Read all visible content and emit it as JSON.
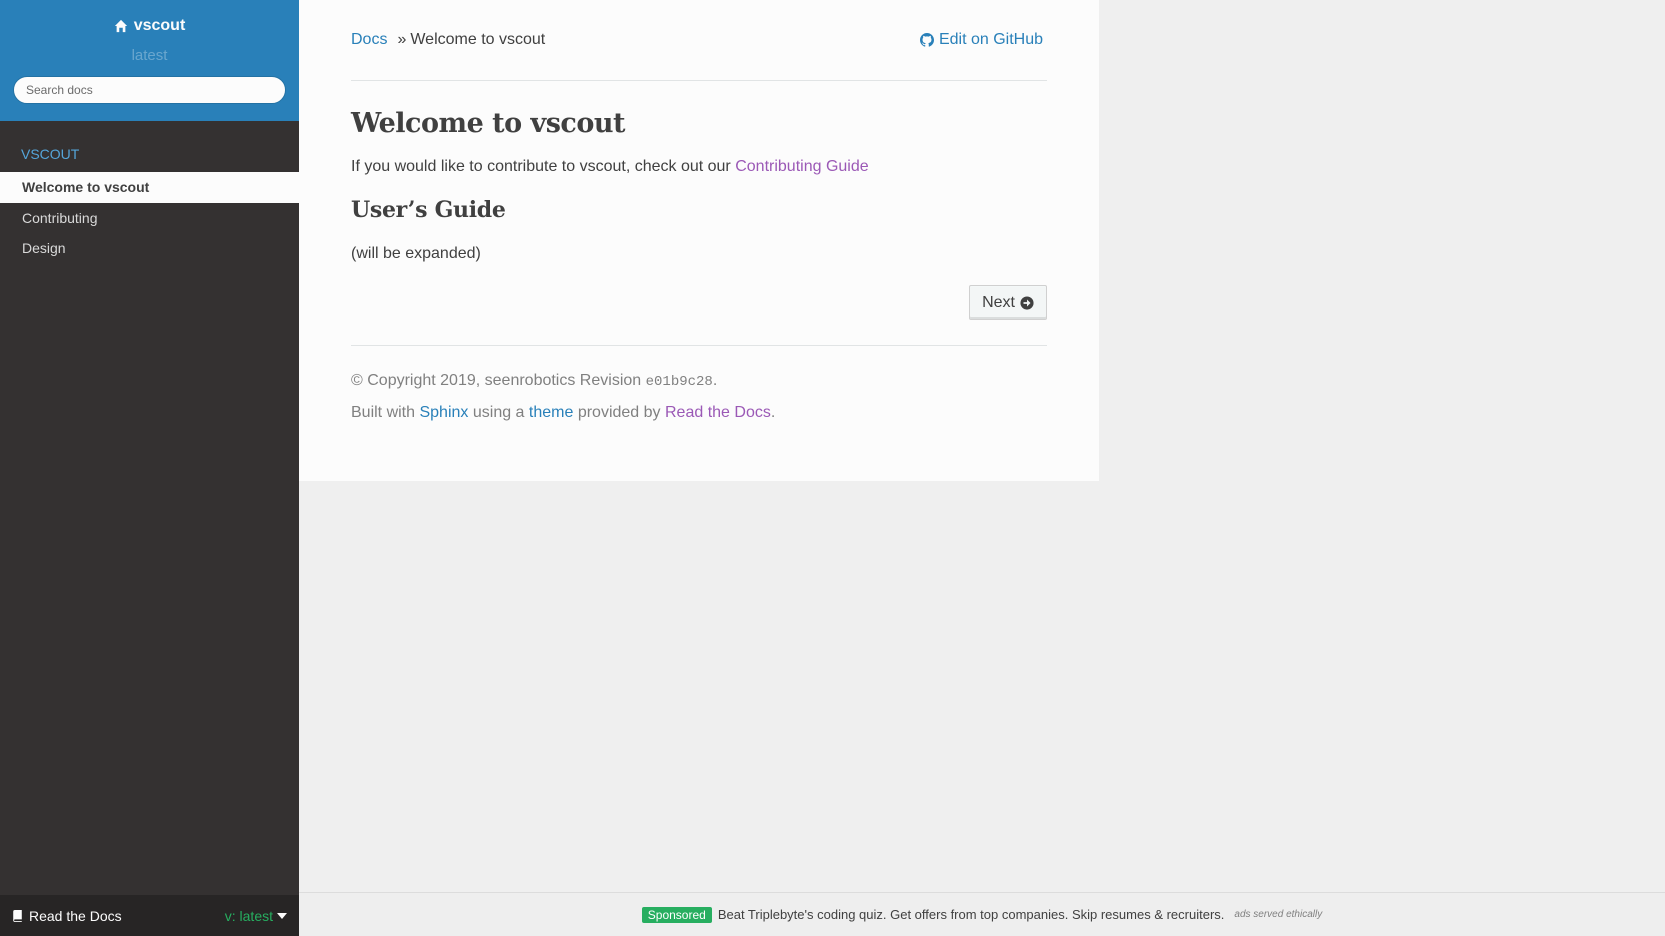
{
  "sidebar": {
    "project_name": "vscout",
    "version": "latest",
    "search_placeholder": "Search docs",
    "caption": "VSCOUT",
    "items": [
      {
        "label": "Welcome to vscout"
      },
      {
        "label": "Contributing"
      },
      {
        "label": "Design"
      }
    ],
    "footer": {
      "label": "Read the Docs",
      "version": "v: latest"
    }
  },
  "breadcrumbs": {
    "root": "Docs",
    "separator": "»",
    "current": "Welcome to vscout",
    "edit_link": "Edit on GitHub"
  },
  "main": {
    "title": "Welcome to vscout",
    "intro_text": "If you would like to contribute to vscout, check out our",
    "intro_link": "Contributing Guide",
    "section_title": "User’s Guide",
    "section_text": "(will be expanded)",
    "next_button": "Next"
  },
  "footer": {
    "copyright": "© Copyright 2019, seenrobotics Revision",
    "revision": "e01b9c28",
    "period": ".",
    "built_with": "Built with",
    "sphinx": "Sphinx",
    "using_a": "using a",
    "theme": "theme",
    "provided_by": "provided by",
    "rtd": "Read the Docs",
    "end": "."
  },
  "ad": {
    "badge": "Sponsored",
    "text": "Beat Triplebyte's coding quiz. Get offers from top companies. Skip resumes & recruiters.",
    "note": "ads served ethically"
  },
  "colors": {
    "brand": "#2980b9",
    "sidebar_bg": "#343131",
    "link_visited": "#9b59b6",
    "badge_green": "#27ae60"
  }
}
